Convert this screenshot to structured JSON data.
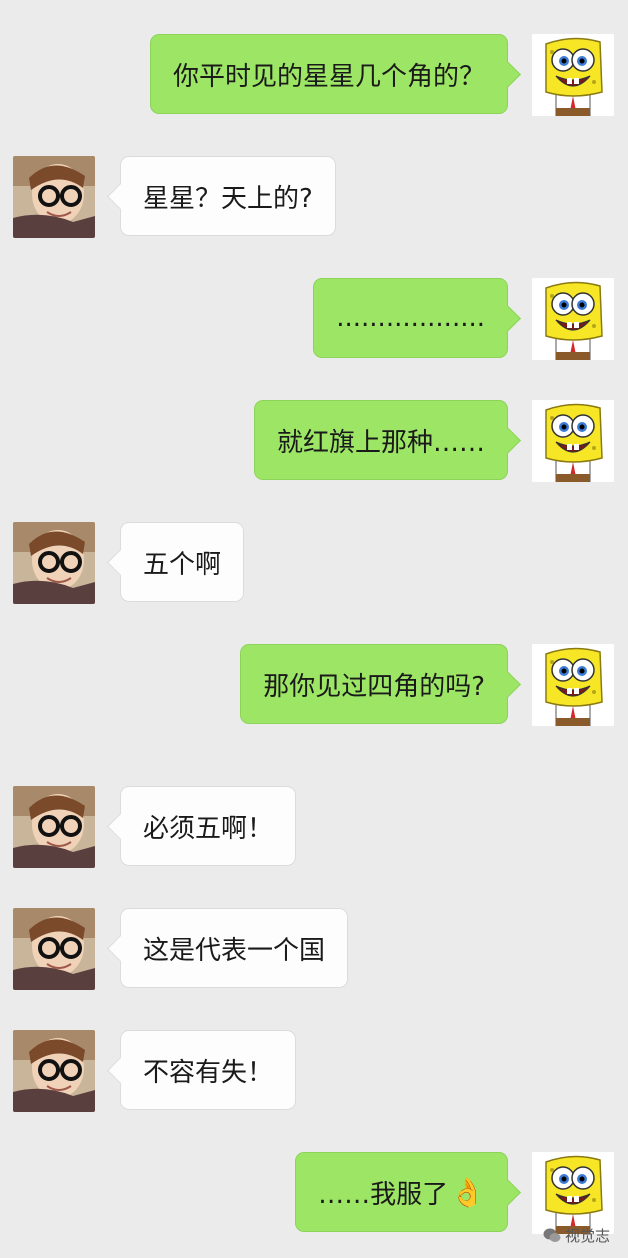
{
  "messages": [
    {
      "side": "right",
      "text": "你平时见的星星几个角的？",
      "avatar": "spongebob-avatar"
    },
    {
      "side": "left",
      "text": "星星？天上的?",
      "avatar": "glasses-guy-avatar"
    },
    {
      "side": "right",
      "text": "..................",
      "avatar": "spongebob-avatar"
    },
    {
      "side": "right",
      "text": "就红旗上那种……",
      "avatar": "spongebob-avatar"
    },
    {
      "side": "left",
      "text": "五个啊",
      "avatar": "glasses-guy-avatar"
    },
    {
      "side": "right",
      "text": "那你见过四角的吗?",
      "avatar": "spongebob-avatar"
    },
    {
      "side": "left",
      "text": "必须五啊！",
      "avatar": "glasses-guy-avatar"
    },
    {
      "side": "left",
      "text": "这是代表一个国",
      "avatar": "glasses-guy-avatar"
    },
    {
      "side": "left",
      "text": "不容有失！",
      "avatar": "glasses-guy-avatar"
    },
    {
      "side": "right",
      "text": "……我服了",
      "emoji": "👌",
      "avatar": "spongebob-avatar"
    }
  ],
  "watermark": {
    "text": "视觉志",
    "icon": "wechat-icon"
  },
  "colors": {
    "background": "#ebebeb",
    "sent_bubble": "#9de665",
    "received_bubble": "#fdfdfd"
  }
}
